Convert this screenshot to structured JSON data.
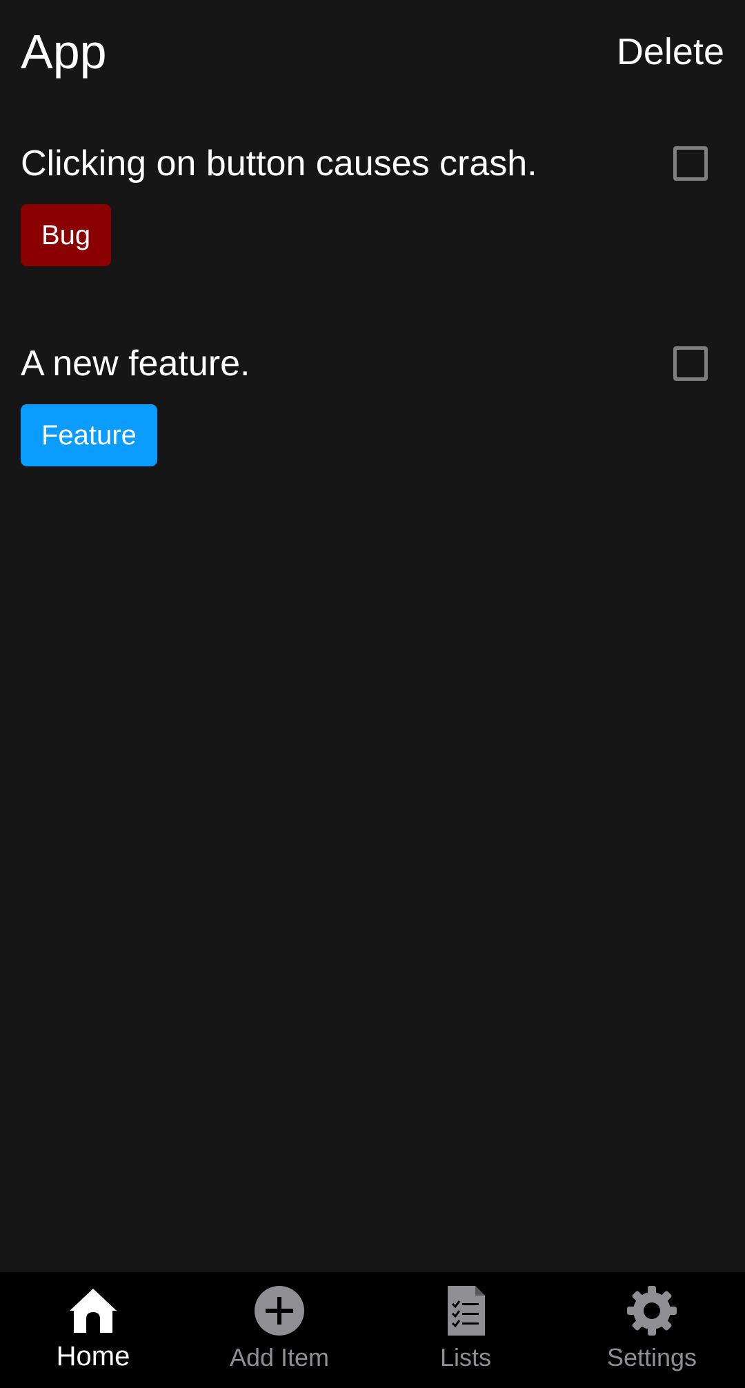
{
  "header": {
    "title": "App",
    "delete_label": "Delete"
  },
  "items": [
    {
      "title": "Clicking on button causes crash.",
      "checked": false,
      "tag": {
        "label": "Bug",
        "color": "#8b0000"
      }
    },
    {
      "title": "A new feature.",
      "checked": false,
      "tag": {
        "label": "Feature",
        "color": "#0a9dff"
      }
    }
  ],
  "bottom_nav": {
    "active_color": "#ffffff",
    "inactive_color": "#8e8e93",
    "items": [
      {
        "label": "Home",
        "icon": "home-icon",
        "active": true
      },
      {
        "label": "Add Item",
        "icon": "add-circle-icon",
        "active": false
      },
      {
        "label": "Lists",
        "icon": "document-checklist-icon",
        "active": false
      },
      {
        "label": "Settings",
        "icon": "gear-icon",
        "active": false
      }
    ]
  }
}
